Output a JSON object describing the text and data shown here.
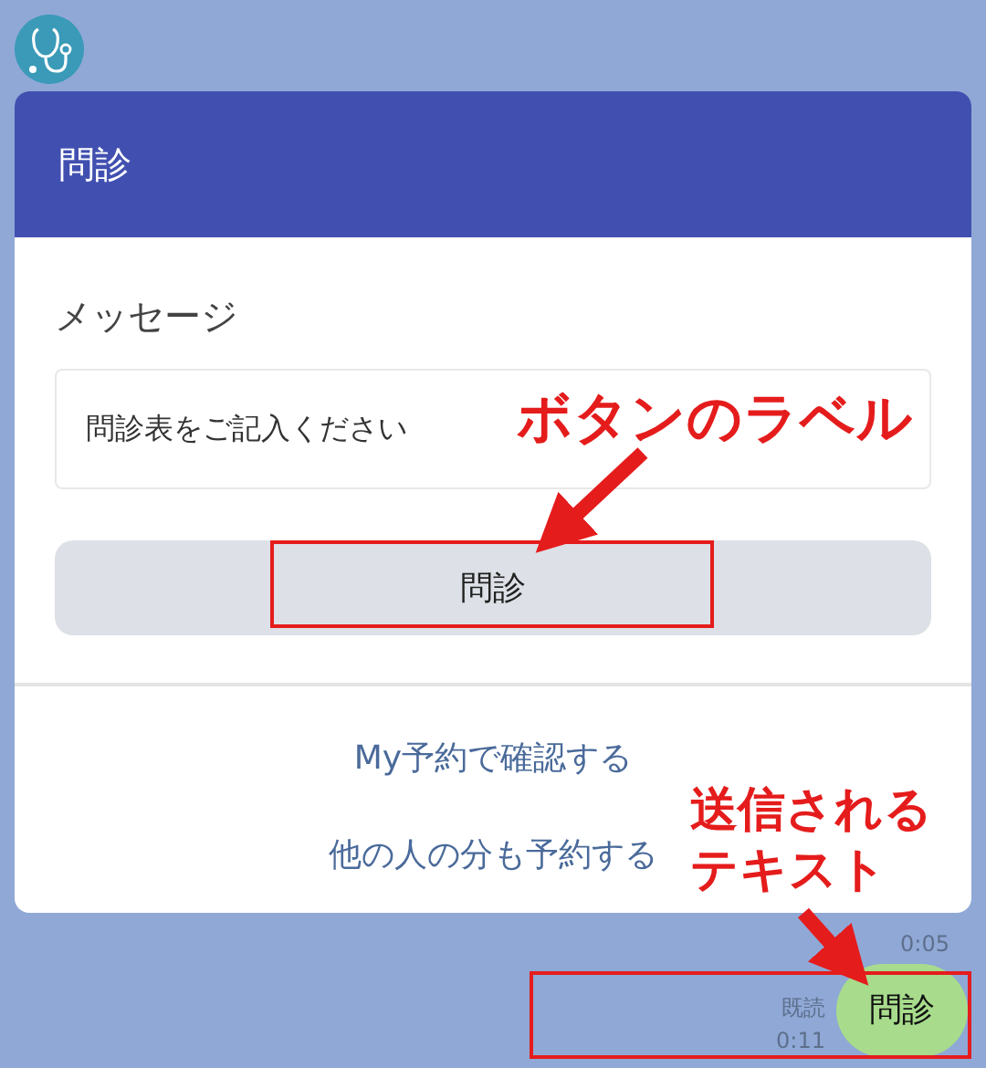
{
  "card": {
    "title": "問診",
    "message_label": "メッセージ",
    "message": "問診表をご記入ください",
    "button": "問診",
    "links": [
      "My予約で確認する",
      "他の人の分も予約する"
    ]
  },
  "chat": {
    "time_above": "0:05",
    "read": "既読",
    "sent_time": "0:11",
    "bubble": "問診"
  },
  "annotations": [
    {
      "text": "ボタンのラベル"
    },
    {
      "text": "送信されるテキスト"
    }
  ]
}
